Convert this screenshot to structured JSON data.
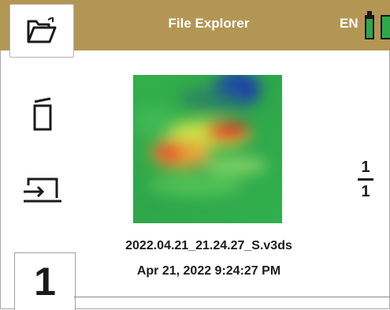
{
  "header": {
    "title": "File Explorer",
    "language": "EN",
    "accent_color": "#b39654"
  },
  "toolbar": {
    "folder_icon": "folder-open-icon",
    "delete_icon": "trash-icon",
    "export_icon": "export-to-laptop-icon"
  },
  "file": {
    "name": "2022.04.21_21.24.27_S.v3ds",
    "datetime": "Apr 21, 2022 9:24:27 PM"
  },
  "pagination": {
    "current": "1",
    "total": "1"
  },
  "badge": {
    "label": "1"
  }
}
